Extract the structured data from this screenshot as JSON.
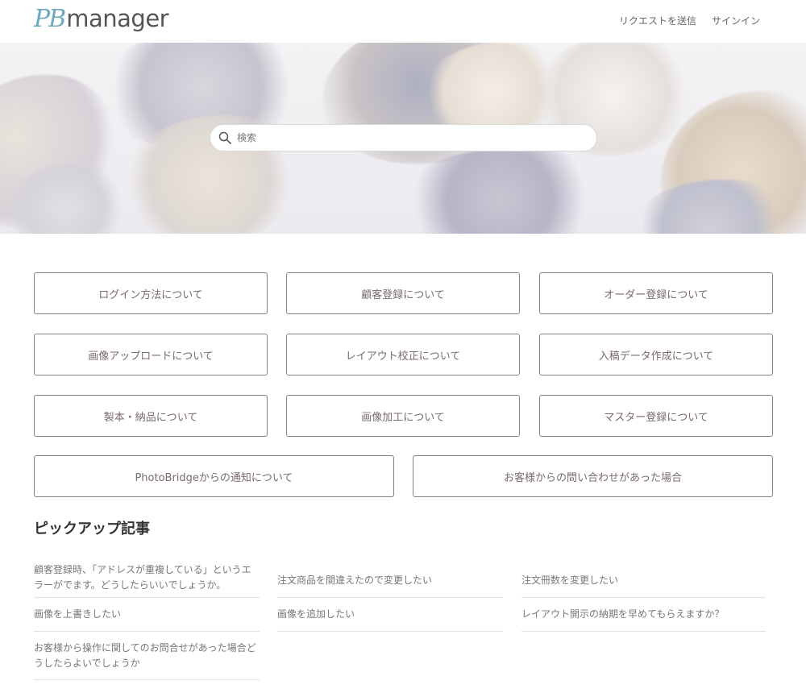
{
  "header": {
    "logo_mark": "PB",
    "logo_word": "manager",
    "nav": [
      "リクエストを送信",
      "サインイン"
    ]
  },
  "hero": {
    "search_placeholder": "検索"
  },
  "categories": [
    "ログイン方法について",
    "顧客登録について",
    "オーダー登録について",
    "画像アップロードについて",
    "レイアウト校正について",
    "入稿データ作成について",
    "製本・納品について",
    "画像加工について",
    "マスター登録について",
    "PhotoBridgeからの通知について",
    "お客様からの問い合わせがあった場合"
  ],
  "pickup": {
    "title": "ピックアップ記事",
    "articles": [
      "顧客登録時、「アドレスが重複している」というエラーがでます。どうしたらいいでしょうか。",
      "注文商品を間違えたので変更したい",
      "注文冊数を変更したい",
      "画像を上書きしたい",
      "画像を追加したい",
      "レイアウト開示の納期を早めてもらえますか？",
      "お客様から操作に関してのお問合せがあった場合どうしたらよいでしょうか"
    ]
  },
  "colors": {
    "logo_accent": "#6fa8bf",
    "category_border": "#8c7e7e",
    "category_text": "#7a6a6a"
  }
}
